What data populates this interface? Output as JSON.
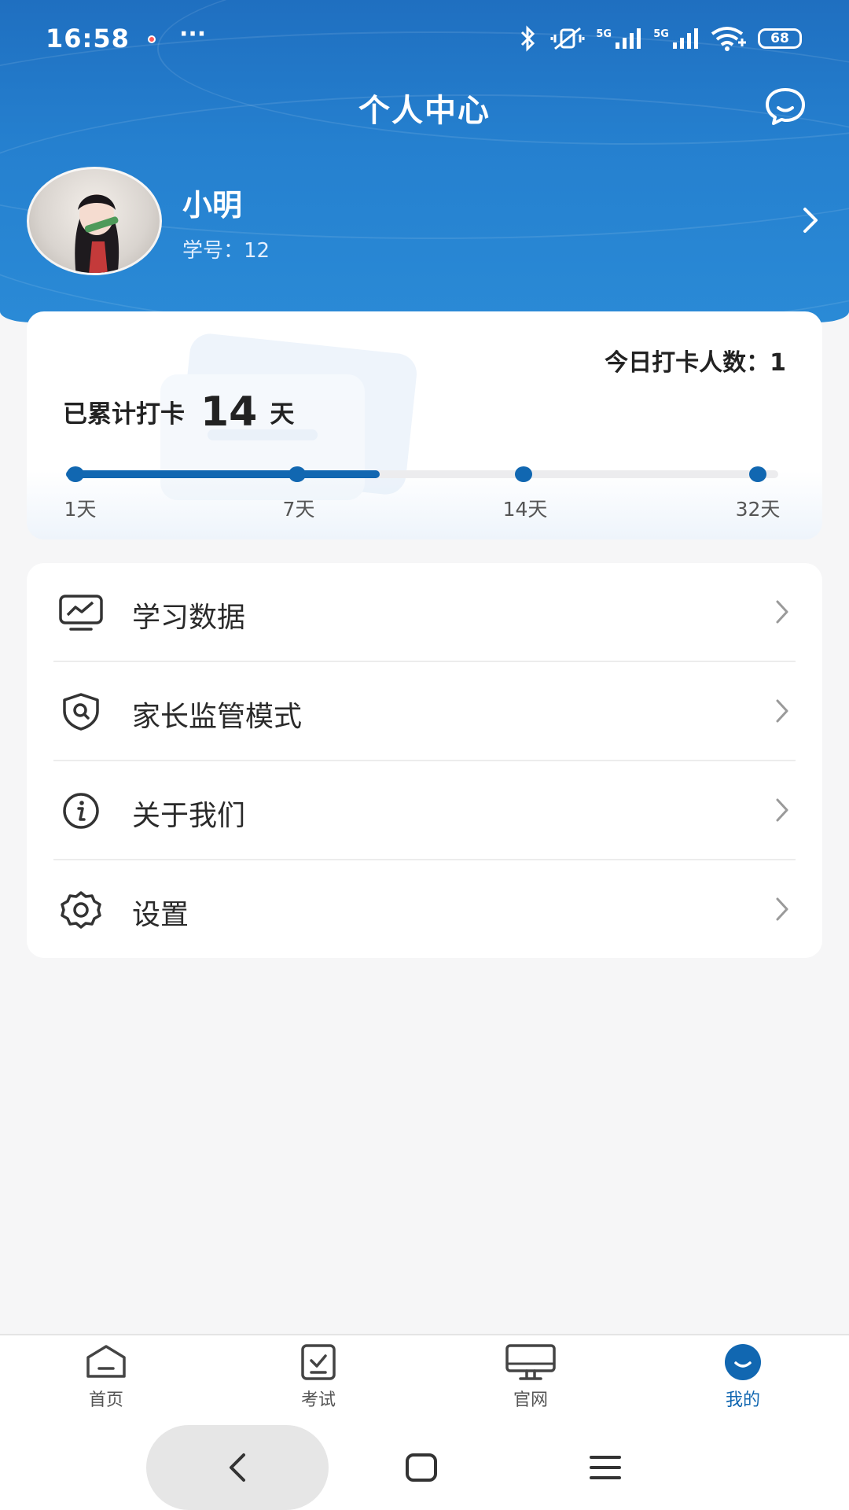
{
  "status_bar": {
    "time": "16:58",
    "more": "···",
    "network_label_1": "5G",
    "network_label_2": "5G",
    "battery": "68"
  },
  "header": {
    "title": "个人中心"
  },
  "profile": {
    "name": "小明",
    "student_id_label": "学号：",
    "student_id": "12"
  },
  "checkin": {
    "today_label": "今日打卡人数：",
    "today_count": "1",
    "total_prefix": "已累计打卡",
    "total_days": "14",
    "total_suffix": "天",
    "progress_fraction": 0.44,
    "milestones": [
      {
        "label": "1天"
      },
      {
        "label": "7天"
      },
      {
        "label": "14天"
      },
      {
        "label": "32天"
      }
    ]
  },
  "menu": {
    "items": [
      {
        "label": "学习数据",
        "icon": "monitor-chart-icon"
      },
      {
        "label": "家长监管模式",
        "icon": "shield-search-icon"
      },
      {
        "label": "关于我们",
        "icon": "info-icon"
      },
      {
        "label": "设置",
        "icon": "gear-icon"
      }
    ]
  },
  "tabbar": {
    "tabs": [
      {
        "label": "首页",
        "icon": "home-icon"
      },
      {
        "label": "考试",
        "icon": "exam-icon"
      },
      {
        "label": "官网",
        "icon": "desktop-icon"
      },
      {
        "label": "我的",
        "icon": "profile-smile-icon",
        "active": true
      }
    ]
  },
  "colors": {
    "accent": "#1167b1",
    "header_blue": "#2580cf"
  }
}
